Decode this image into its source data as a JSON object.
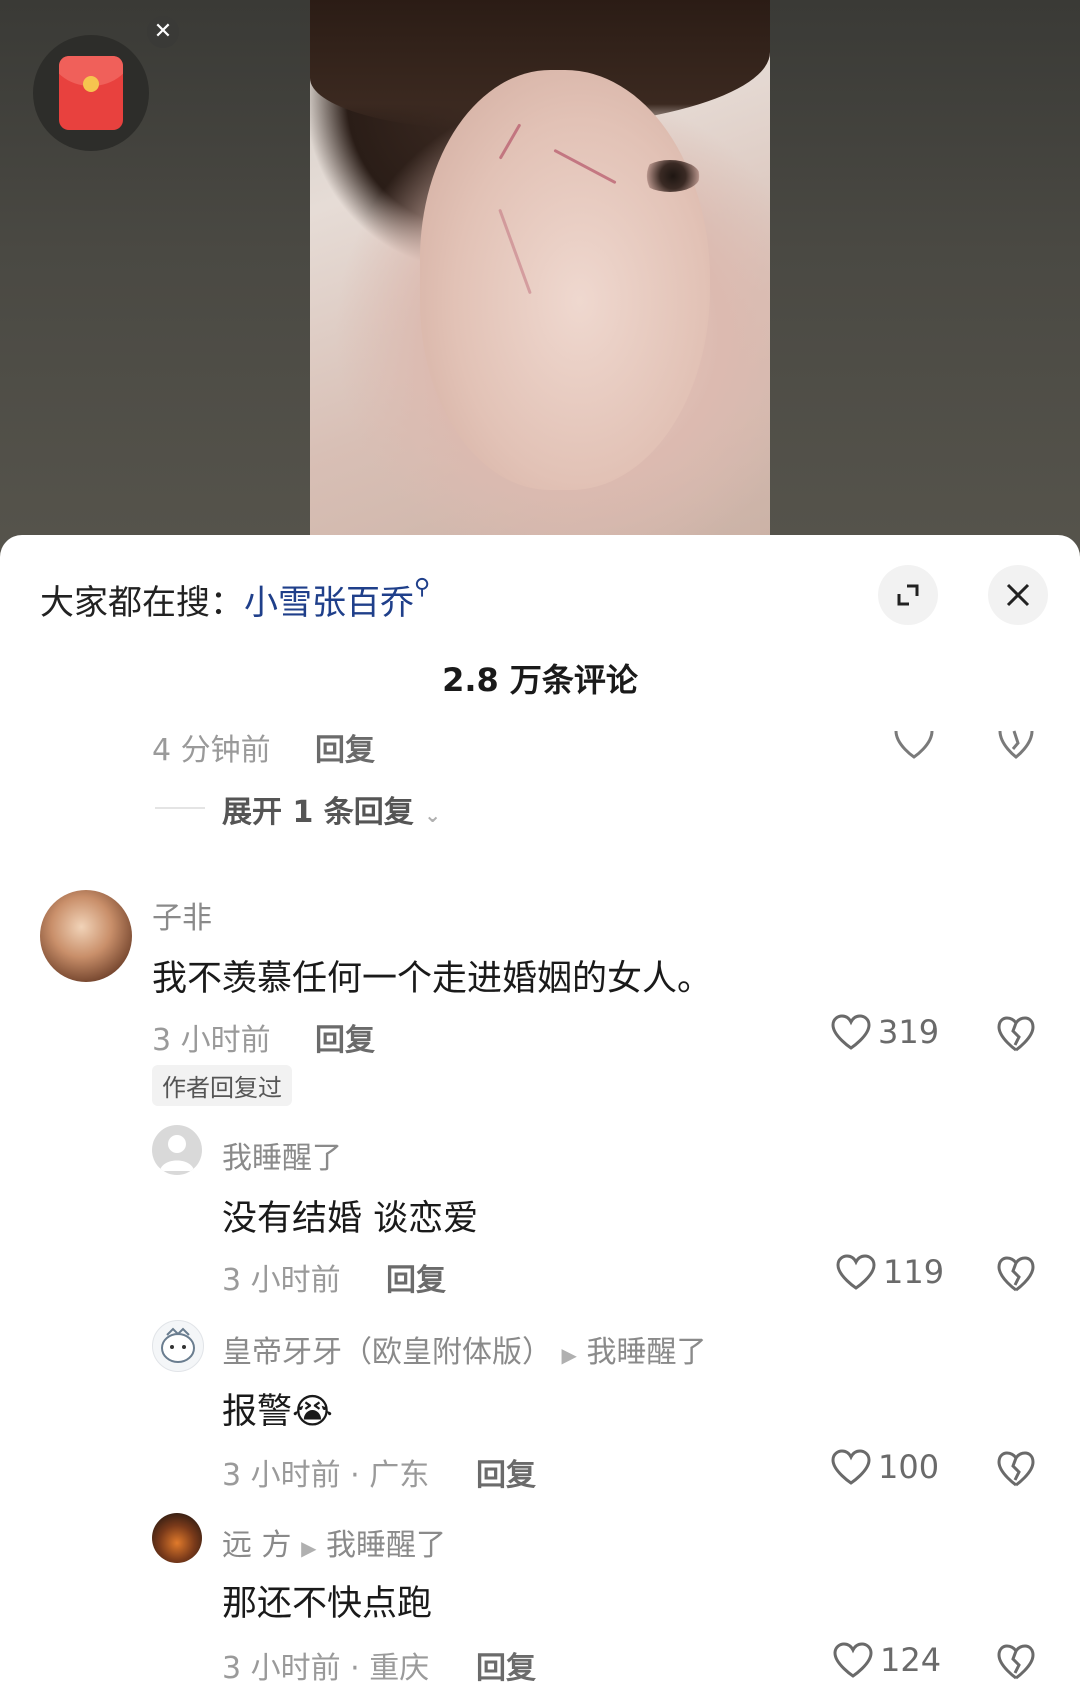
{
  "video": {
    "close_glyph": "✕"
  },
  "panel": {
    "search_prefix": "大家都在搜：",
    "search_keyword": "小雪张百乔",
    "comment_count": "2.8 万条评论"
  },
  "top_partial": {
    "time": "4 分钟前",
    "reply": "回复"
  },
  "expand_label": "展开 1 条回复",
  "comments": [
    {
      "user": "子非",
      "text": "我不羡慕任何一个走进婚姻的女人。",
      "time": "3 小时前",
      "reply": "回复",
      "likes": "319",
      "tag": "作者回复过"
    }
  ],
  "replies": [
    {
      "user": "我睡醒了",
      "text": "没有结婚 谈恋爱",
      "time": "3 小时前",
      "reply": "回复",
      "likes": "119"
    },
    {
      "user": "皇帝牙牙（欧皇附体版）",
      "target": "我睡醒了",
      "text": "报警",
      "emoji": "😭",
      "time": "3 小时前 · 广东",
      "reply": "回复",
      "likes": "100"
    },
    {
      "user": "远 方",
      "target": "我睡醒了",
      "text": "那还不快点跑",
      "time": "3 小时前 · 重庆",
      "reply": "回复",
      "likes": "124"
    }
  ]
}
